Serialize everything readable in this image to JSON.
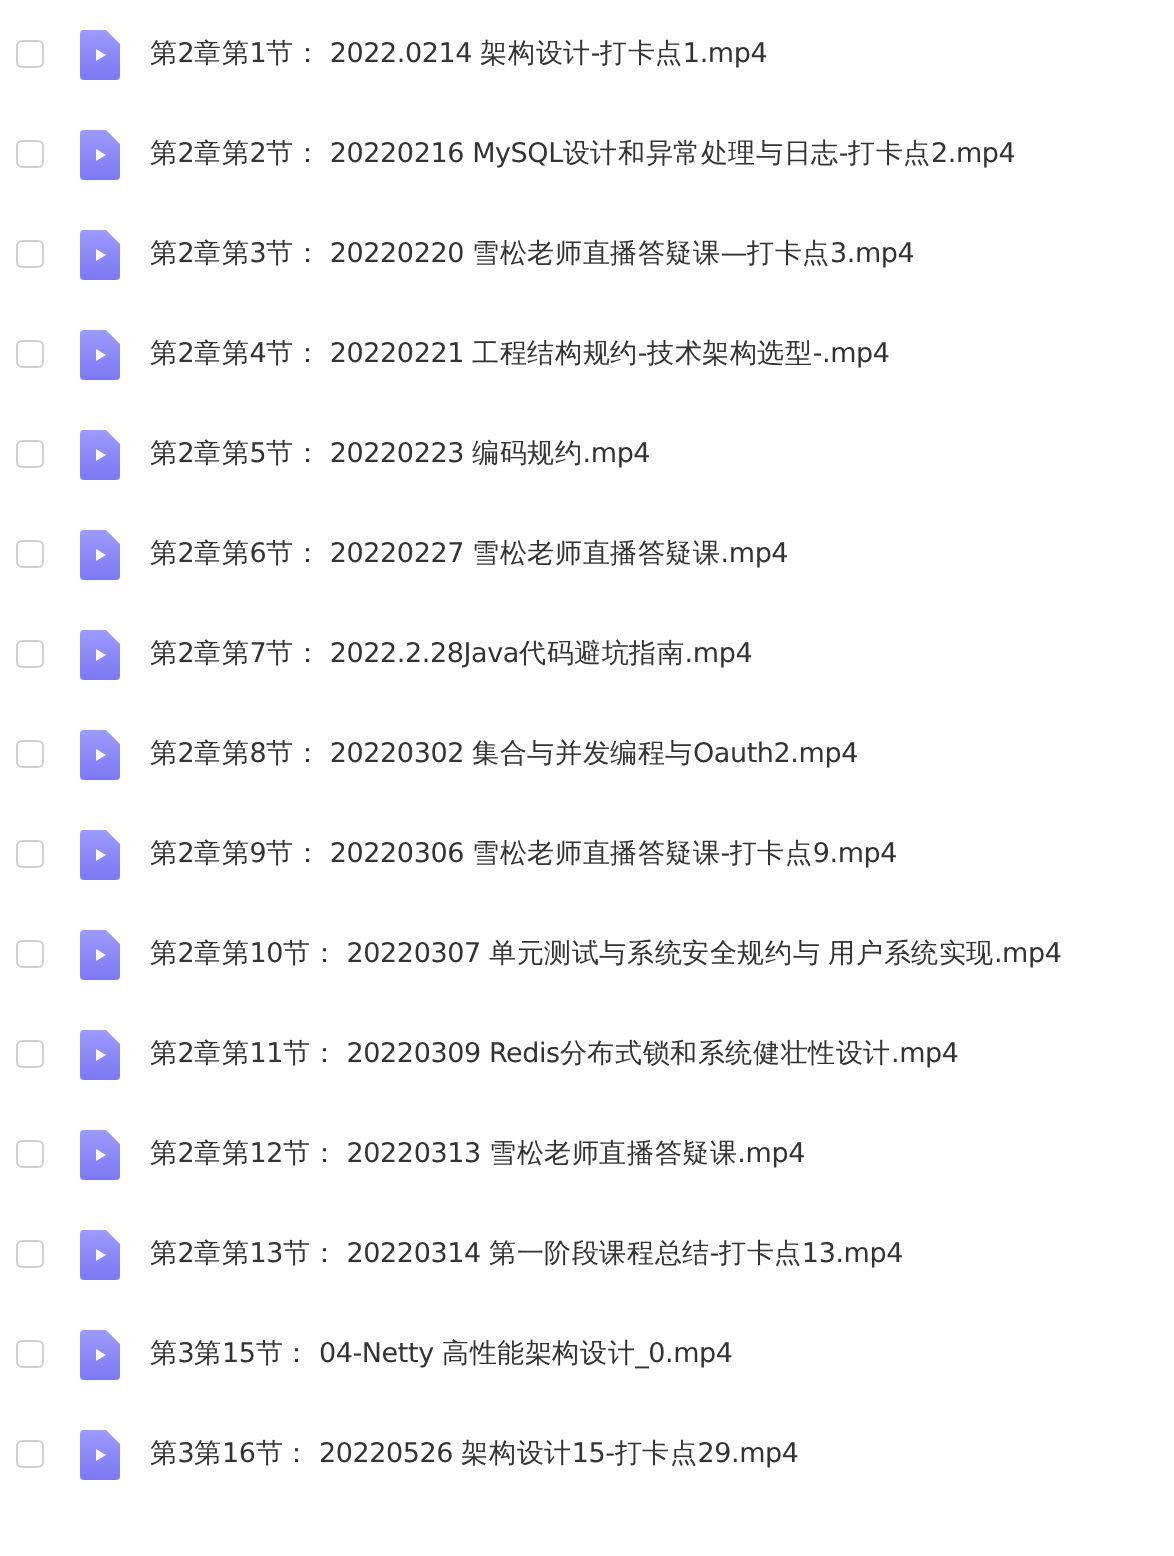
{
  "files": [
    {
      "name": "第2章第1节： 2022.0214 架构设计-打卡点1.mp4",
      "checked": false
    },
    {
      "name": "第2章第2节： 20220216 MySQL设计和异常处理与日志-打卡点2.mp4",
      "checked": false
    },
    {
      "name": "第2章第3节： 20220220 雪松老师直播答疑课—打卡点3.mp4",
      "checked": false
    },
    {
      "name": "第2章第4节： 20220221 工程结构规约-技术架构选型-.mp4",
      "checked": false
    },
    {
      "name": "第2章第5节： 20220223 编码规约.mp4",
      "checked": false
    },
    {
      "name": "第2章第6节： 20220227 雪松老师直播答疑课.mp4",
      "checked": false
    },
    {
      "name": "第2章第7节： 2022.2.28Java代码避坑指南.mp4",
      "checked": false
    },
    {
      "name": "第2章第8节： 20220302 集合与并发编程与Oauth2.mp4",
      "checked": false
    },
    {
      "name": "第2章第9节： 20220306 雪松老师直播答疑课-打卡点9.mp4",
      "checked": false
    },
    {
      "name": "第2章第10节： 20220307 单元测试与系统安全规约与 用户系统实现.mp4",
      "checked": false
    },
    {
      "name": "第2章第11节： 20220309 Redis分布式锁和系统健壮性设计.mp4",
      "checked": false
    },
    {
      "name": "第2章第12节： 20220313 雪松老师直播答疑课.mp4",
      "checked": false
    },
    {
      "name": "第2章第13节： 20220314 第一阶段课程总结-打卡点13.mp4",
      "checked": false
    },
    {
      "name": "第3第15节： 04-Netty 高性能架构设计_0.mp4",
      "checked": false
    },
    {
      "name": "第3第16节： 20220526 架构设计15-打卡点29.mp4",
      "checked": false
    }
  ]
}
